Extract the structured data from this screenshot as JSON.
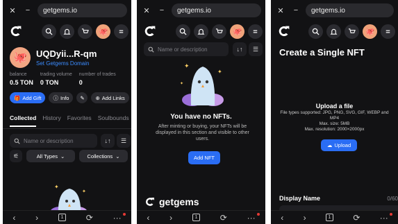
{
  "browser": {
    "url": "getgems.io",
    "close_icon": "✕",
    "minimize_icon": "−"
  },
  "bottom_nav": {
    "back": "‹",
    "forward": "›",
    "tabs_count": "1",
    "refresh": "⟳",
    "menu": "···"
  },
  "screen1": {
    "profile": {
      "name": "UQDyii...R-qm",
      "domain_link": "Set Getgems Domain"
    },
    "stats": [
      {
        "label": "balance",
        "value": "0.5 TON"
      },
      {
        "label": "trading volume",
        "value": "0 TON"
      },
      {
        "label": "number of trades",
        "value": "0"
      }
    ],
    "actions": {
      "add_gift": "Add Gift",
      "info": "Info",
      "add_links": "Add Links"
    },
    "tabs": [
      "Collected",
      "History",
      "Favorites",
      "Soulbounds"
    ],
    "search": {
      "placeholder": "Name or description",
      "sort_icon": "↓↑"
    },
    "filters": {
      "types": "All Types",
      "collections": "Collections"
    }
  },
  "screen2": {
    "search": {
      "placeholder": "Name or description",
      "sort_icon": "↓↑"
    },
    "empty": {
      "title": "You have no NFTs.",
      "text": "After minting or buying, your NFTs will be displayed in this section and visible to other users.",
      "button": "Add NFT"
    },
    "footer_logo": "getgems"
  },
  "screen3": {
    "title": "Create a Single NFT",
    "upload": {
      "title": "Upload a file",
      "formats": "File types supported: JPG, PNG, SVG, GIF, WEBP and MP4",
      "max_size": "Max. size: 5MB",
      "resolution": "Max. resolution: 2000×2000px",
      "button": "Upload"
    },
    "display_name": {
      "label": "Display Name",
      "count": "0/60"
    }
  },
  "colors": {
    "accent": "#2a6df4",
    "background": "#121214"
  }
}
